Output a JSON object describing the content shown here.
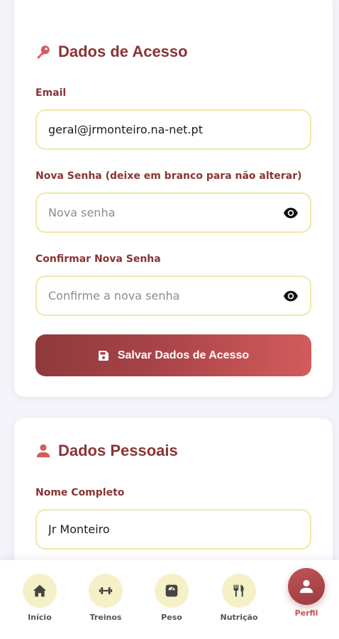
{
  "access_card": {
    "title": "Dados de Acesso",
    "icon": "key-icon",
    "email": {
      "label": "Email",
      "value": "geral@jrmonteiro.na-net.pt"
    },
    "new_password": {
      "label": "Nova Senha (deixe em branco para não alterar)",
      "placeholder": "Nova senha",
      "value": ""
    },
    "confirm_password": {
      "label": "Confirmar Nova Senha",
      "placeholder": "Confirme a nova senha",
      "value": ""
    },
    "save_button": {
      "label": "Salvar Dados de Acesso",
      "icon": "save-icon"
    }
  },
  "personal_card": {
    "title": "Dados Pessoais",
    "icon": "user-icon",
    "full_name": {
      "label": "Nome Completo",
      "value": "Jr Monteiro"
    }
  },
  "bottom_nav": {
    "items": [
      {
        "label": "Início",
        "icon": "home-icon",
        "active": false
      },
      {
        "label": "Treinos",
        "icon": "dumbbell-icon",
        "active": false
      },
      {
        "label": "Peso",
        "icon": "scale-icon",
        "active": false
      },
      {
        "label": "Nutrição",
        "icon": "utensils-icon",
        "active": false
      },
      {
        "label": "Perfil",
        "icon": "user-icon",
        "active": true
      }
    ]
  },
  "colors": {
    "accent": "#8a3434",
    "accent_light": "#d35b5c",
    "field_border": "#f1e7a9",
    "nav_circle": "#f6f0c8",
    "background": "#f4f4fb"
  }
}
